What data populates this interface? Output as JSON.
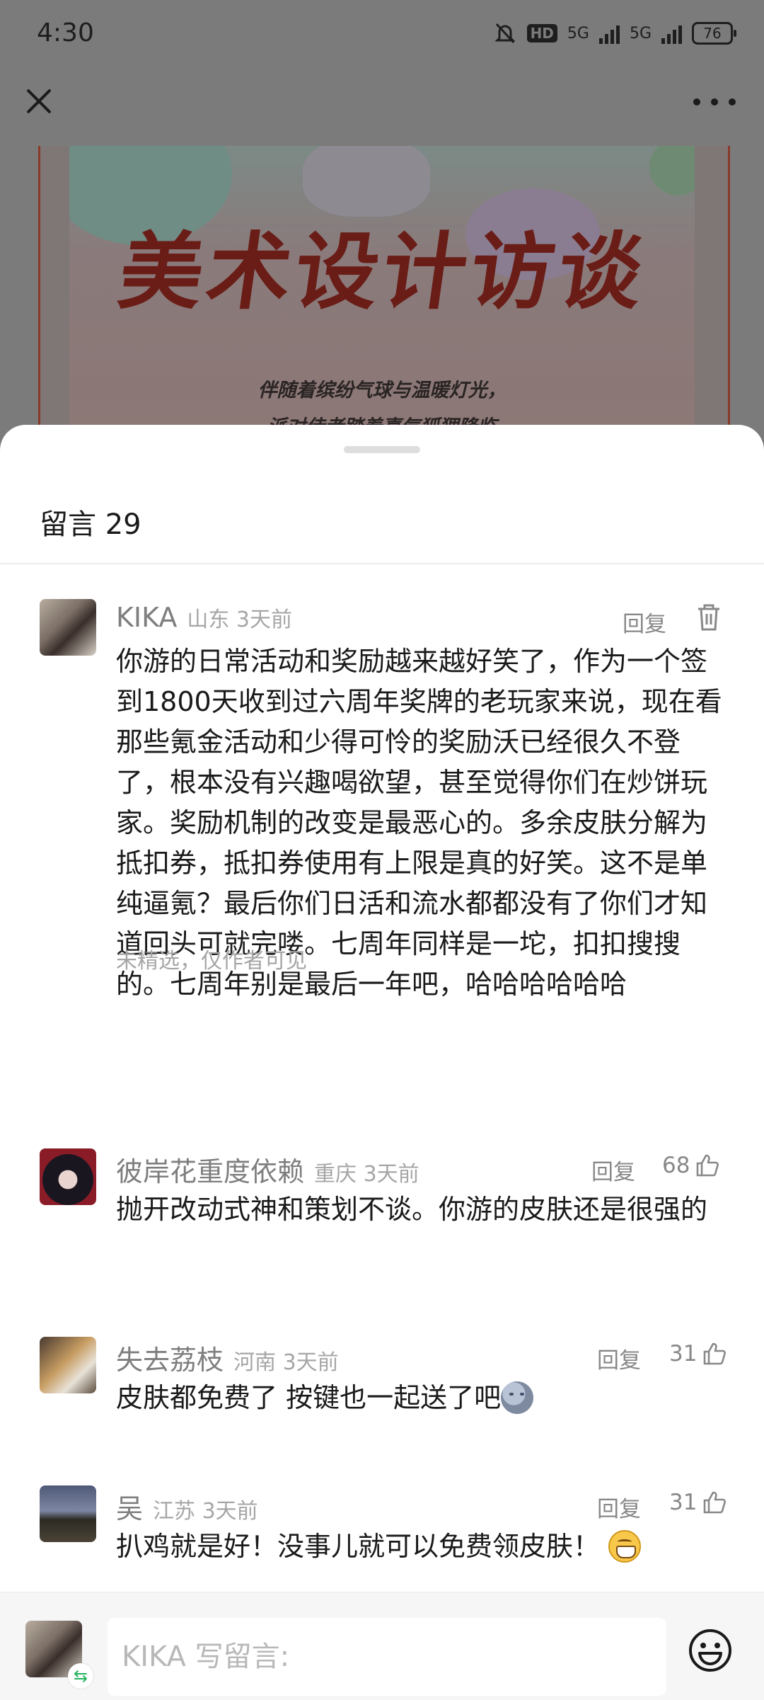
{
  "status_bar": {
    "time": "4:30",
    "hd_label": "HD",
    "net1": "5G",
    "net2": "5G",
    "battery": "76"
  },
  "article": {
    "title": "美术设计访谈",
    "caption_line1": "伴随着缤纷气球与温暖灯光，",
    "caption_line2": "派对侍者踏着喜气狐狸降临"
  },
  "sheet": {
    "title": "留言 29"
  },
  "comments": [
    {
      "name": "KIKA",
      "location": "山东",
      "time": "3天前",
      "reply_label": "回复",
      "body": "你游的日常活动和奖励越来越好笑了，作为一个签到1800天收到过六周年奖牌的老玩家来说，现在看那些氪金活动和少得可怜的奖励沃已经很久不登了，根本没有兴趣喝欲望，甚至觉得你们在炒饼玩家。奖励机制的改变是最恶心的。多余皮肤分解为抵扣券，抵扣券使用有上限是真的好笑。这不是单纯逼氪？最后你们日活和流水都都没有了你们才知道回头可就完喽。七周年同样是一坨，扣扣搜搜的。七周年别是最后一年吧，哈哈哈哈哈哈",
      "note": "未精选，仅作者可见"
    },
    {
      "name": "彼岸花重度依赖",
      "location": "重庆",
      "time": "3天前",
      "reply_label": "回复",
      "likes": "68",
      "body": "抛开改动式神和策划不谈。你游的皮肤还是很强的"
    },
    {
      "name": "失去荔枝",
      "location": "河南",
      "time": "3天前",
      "reply_label": "回复",
      "likes": "31",
      "body": "皮肤都免费了 按键也一起送了吧"
    },
    {
      "name": "吴",
      "location": "江苏",
      "time": "3天前",
      "reply_label": "回复",
      "likes": "31",
      "body": "扒鸡就是好！没事儿就可以免费领皮肤！"
    }
  ],
  "input_bar": {
    "placeholder": "KIKA 写留言:",
    "switch_glyph": "⇆"
  },
  "icons": {
    "close": "close-icon",
    "more": "more-icon",
    "delete": "trash-icon",
    "like": "thumbs-up-icon",
    "emoji": "smiley-icon"
  }
}
